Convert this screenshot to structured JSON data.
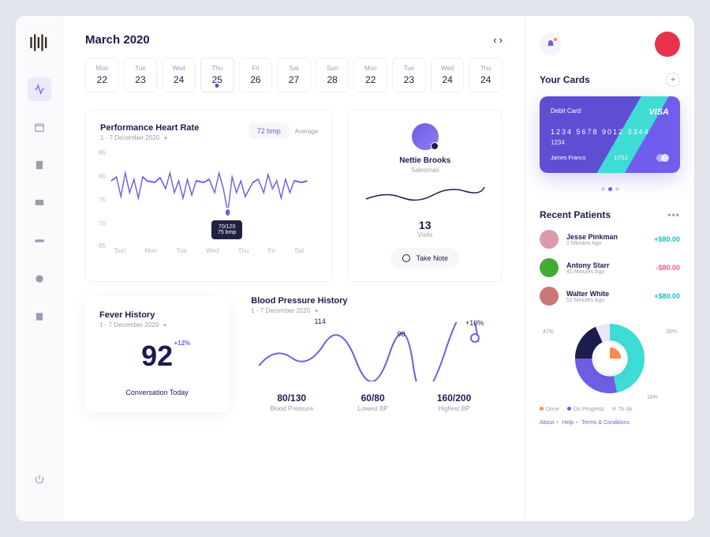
{
  "header": {
    "month": "March 2020"
  },
  "dates": [
    {
      "dow": "Mon",
      "num": "22"
    },
    {
      "dow": "Tue",
      "num": "23"
    },
    {
      "dow": "Wed",
      "num": "24"
    },
    {
      "dow": "Thu",
      "num": "25",
      "selected": true
    },
    {
      "dow": "Fri",
      "num": "26"
    },
    {
      "dow": "Sat",
      "num": "27"
    },
    {
      "dow": "Sun",
      "num": "28"
    },
    {
      "dow": "Mon",
      "num": "22"
    },
    {
      "dow": "Tue",
      "num": "23"
    },
    {
      "dow": "Wed",
      "num": "24"
    },
    {
      "dow": "Thu",
      "num": "24"
    }
  ],
  "heart": {
    "title": "Performance Heart Rate",
    "range": "1 - 7 December 2020",
    "avg_value": "72 bmp",
    "avg_label": "Average",
    "y_ticks": [
      "85",
      "80",
      "75",
      "70",
      "65"
    ],
    "x_ticks": [
      "Sun",
      "Mon",
      "Tue",
      "Wed",
      "Thu",
      "Fri",
      "Sat"
    ],
    "tooltip_line1": "70/120",
    "tooltip_line2": "75 bmp"
  },
  "profile": {
    "name": "Nettie Brooks",
    "role": "Salesman",
    "visits_num": "13",
    "visits_label": "Visits",
    "take_note": "Take Note"
  },
  "fever": {
    "title": "Fever History",
    "range": "1 - 7 December 2020",
    "value": "92",
    "pct": "+12%",
    "footer": "Conversation Today"
  },
  "bp": {
    "title": "Blood Pressure History",
    "range": "1 - 7 December 2020",
    "p1": "114",
    "p2": "98",
    "p3": "+10%",
    "stats": [
      {
        "val": "80/130",
        "lbl": "Blood Pressure"
      },
      {
        "val": "60/80",
        "lbl": "Lowest BP"
      },
      {
        "val": "160/200",
        "lbl": "Highest BP"
      }
    ]
  },
  "right": {
    "cards_title": "Your Cards",
    "card": {
      "type": "Debit Card",
      "brand": "VISA",
      "number": "1234   5678   9012   3344",
      "last": "1234",
      "holder": "James Franco",
      "expiry": "17/12"
    },
    "patients_title": "Recent Patients",
    "patients": [
      {
        "name": "Jesse Pinkman",
        "time": "2 Minutes Ago",
        "amt": "+$80.00",
        "cls": "pos",
        "col": "#d9a"
      },
      {
        "name": "Antony Starr",
        "time": "41 Minutes Ago",
        "amt": "-$80.00",
        "cls": "neg",
        "col": "#4a3"
      },
      {
        "name": "Walter White",
        "time": "52 Minutes Ago",
        "amt": "+$80.00",
        "cls": "pos",
        "col": "#c77"
      }
    ],
    "donut": {
      "a": "47%",
      "b": "28%",
      "c": "18%"
    },
    "legend": [
      {
        "label": "Done",
        "c": "#ff8b4a"
      },
      {
        "label": "On Progress",
        "c": "#6d5ee5"
      },
      {
        "label": "To do",
        "c": "#d3d0ef"
      }
    ],
    "footer": {
      "about": "About",
      "help": "Help",
      "terms": "Terms & Conditions"
    }
  },
  "chart_data": [
    {
      "type": "line",
      "title": "Performance Heart Rate",
      "ylabel": "bmp",
      "ylim": [
        65,
        85
      ],
      "categories": [
        "Sun",
        "Mon",
        "Tue",
        "Wed",
        "Thu",
        "Fri",
        "Sat"
      ],
      "values": [
        80,
        79,
        81,
        75,
        80,
        82,
        79
      ],
      "tooltip": {
        "day": "Wed",
        "bp": "70/120",
        "bmp": 75
      }
    },
    {
      "type": "line",
      "title": "Blood Pressure History",
      "points": [
        {
          "label": "114",
          "v": 114
        },
        {
          "label": "98",
          "v": 98
        },
        {
          "label": "+10%",
          "v": 108
        }
      ],
      "stats": {
        "blood_pressure": "80/130",
        "lowest": "60/80",
        "highest": "160/200"
      }
    },
    {
      "type": "pie",
      "title": "Progress",
      "series": [
        {
          "name": "Done",
          "value": 47
        },
        {
          "name": "On Progress",
          "value": 28
        },
        {
          "name": "To do",
          "value": 18
        }
      ]
    }
  ]
}
